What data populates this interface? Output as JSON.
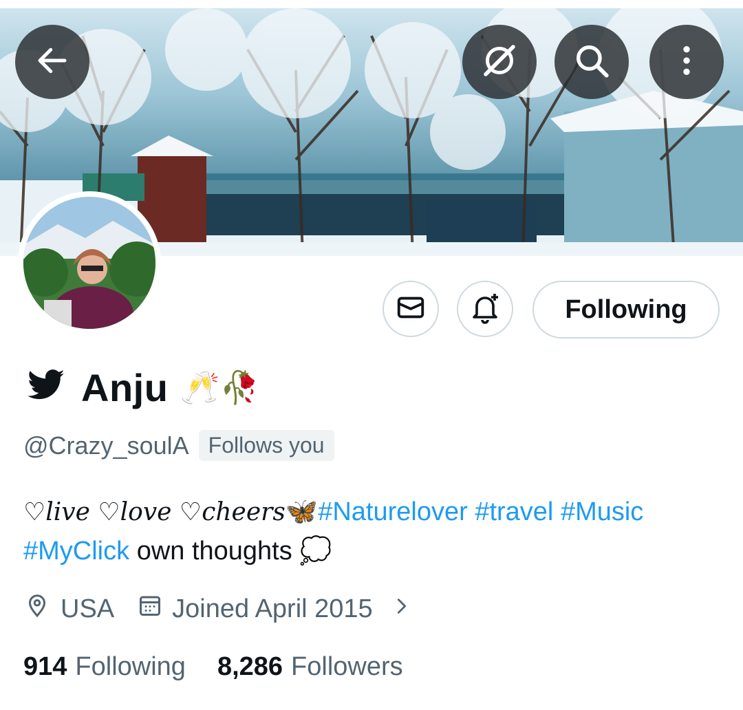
{
  "header": {
    "back_icon": "arrow-left-icon",
    "grok_icon": "grok-icon",
    "search_icon": "search-icon",
    "more_icon": "more-vertical-icon"
  },
  "actions": {
    "message_icon": "envelope-icon",
    "notify_icon": "bell-plus-icon",
    "following_label": "Following"
  },
  "profile": {
    "platform_icon": "twitter-bird-icon",
    "name": "Anju",
    "name_emojis": "🥂🥀",
    "handle": "@Crazy_soulA",
    "follows_you": "Follows you",
    "bio": {
      "heart_text": "♡live ♡love ♡cheers",
      "butterfly": "🦋",
      "tags_line1": [
        "#Naturelover",
        "#travel",
        "#Music"
      ],
      "tag_line2": "#MyClick",
      "plain": "own thoughts",
      "thought_emoji": "💭"
    },
    "location": "USA",
    "joined": "Joined April 2015"
  },
  "stats": {
    "following_count": "914",
    "following_label": "Following",
    "followers_count": "8,286",
    "followers_label": "Followers"
  },
  "colors": {
    "accent": "#1d9bf0",
    "text": "#0f1419",
    "muted": "#536471",
    "border": "#cfd9de"
  }
}
